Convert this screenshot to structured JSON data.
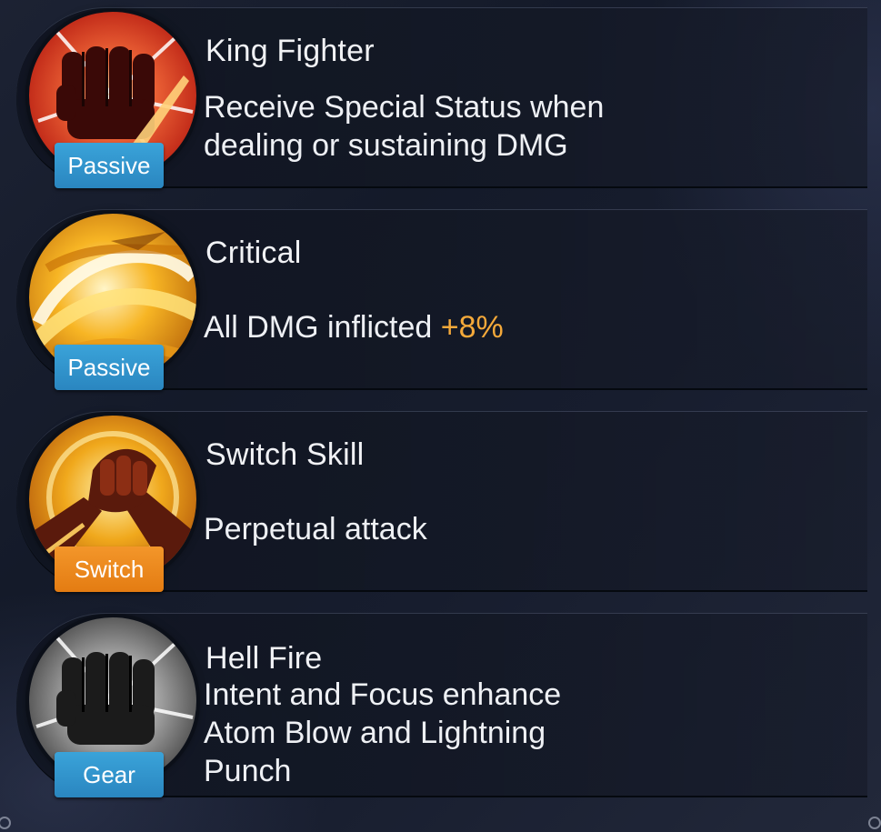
{
  "skills": [
    {
      "title": "King Fighter",
      "description_lines": [
        "Receive Special Status when",
        "dealing or sustaining DMG"
      ],
      "tag": "Passive",
      "icon": "fist-burst-icon"
    },
    {
      "title": "Critical",
      "description": "All DMG inflicted ",
      "description_highlight": "+8%",
      "tag": "Passive",
      "icon": "golden-slash-icon"
    },
    {
      "title": "Switch Skill",
      "description": "Perpetual attack",
      "tag": "Switch",
      "icon": "handshake-icon"
    },
    {
      "title": "Hell Fire",
      "description_lines": [
        "Intent and Focus enhance",
        "Atom Blow and Lightning",
        "Punch"
      ],
      "tag": "Gear",
      "icon": "gray-fist-icon"
    }
  ],
  "colors": {
    "tag_blue": "#2f93cf",
    "tag_orange": "#ee8a1f",
    "highlight": "#f4a93a"
  }
}
